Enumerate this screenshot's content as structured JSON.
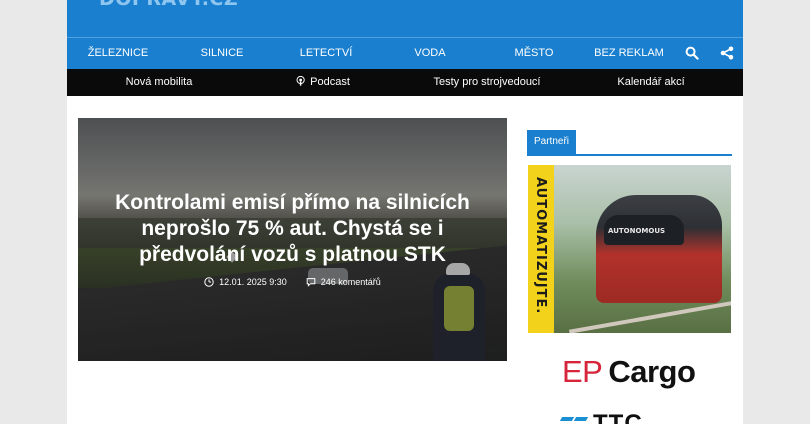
{
  "header": {
    "logo_text": "DOPRAVY.CZ"
  },
  "main_nav": {
    "items": [
      "ŽELEZNICE",
      "SILNICE",
      "LETECTVÍ",
      "VODA",
      "MĚSTO",
      "BEZ REKLAM"
    ],
    "search_icon": "search-icon",
    "share_icon": "share-icon"
  },
  "sub_nav": {
    "items": [
      "Nová mobilita",
      "Podcast",
      "Testy pro strojvedoucí",
      "Kalendář akcí"
    ],
    "podcast_icon": "podcast-icon"
  },
  "hero": {
    "title": "Kontrolami emisí přímo na silnicích neprošlo 75 % aut. Chystá se i předvolání vozů s platnou STK",
    "date": "12.01. 2025 9:30",
    "comments": "246 komentářů",
    "clock_icon": "clock-icon",
    "comment_icon": "comment-icon"
  },
  "sidebar": {
    "heading": "Partneři",
    "ad_vertical_text": "AUTOMATIZUJTE.",
    "ad_tram_text": "AUTONOMOUS",
    "partner1_part1": "EP",
    "partner1_part2": "Cargo",
    "partner2": "TTC"
  },
  "colors": {
    "brand_blue": "#1a7fce",
    "subnav_black": "#0a0a0a",
    "ep_red": "#d6243a"
  }
}
